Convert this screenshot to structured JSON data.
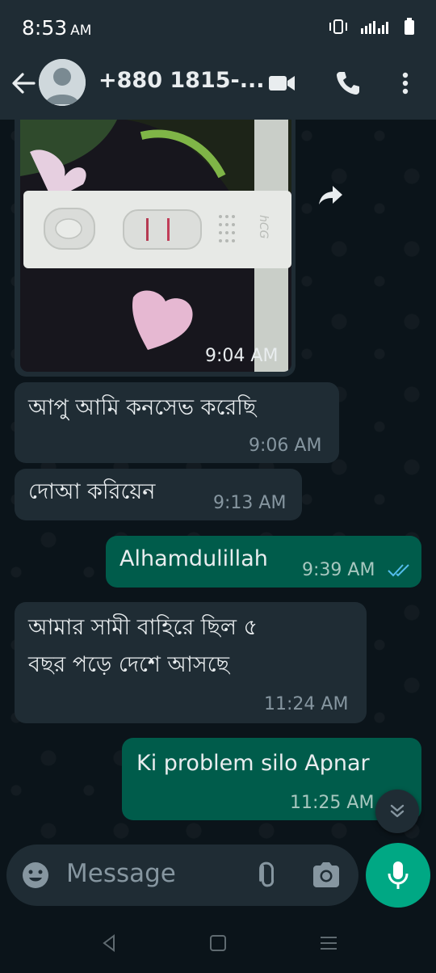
{
  "status_bar": {
    "time": "8:53",
    "ampm": "AM"
  },
  "header": {
    "contact_name": "+880 1815-..."
  },
  "messages": [
    {
      "direction": "in",
      "type": "image",
      "time": "9:04 AM",
      "image_text": "hCG"
    },
    {
      "direction": "in",
      "text": "আপু আমি কনসেভ করেছি",
      "time": "9:06 AM"
    },
    {
      "direction": "in",
      "text": "দোআ করিয়েন",
      "time": "9:13 AM"
    },
    {
      "direction": "out",
      "text": "Alhamdulillah",
      "time": "9:39 AM",
      "status": "read"
    },
    {
      "direction": "in",
      "text_lines": [
        "আমার সামী বাহিরে ছিল ৫",
        "বছর পড়ে দেশে আসছে"
      ],
      "time": "11:24 AM"
    },
    {
      "direction": "out",
      "text": "Ki problem silo Apnar",
      "time": "11:25 AM"
    }
  ],
  "composer": {
    "placeholder": "Message"
  },
  "colors": {
    "background": "#0b141a",
    "header": "#1f2c34",
    "incoming": "#1f2c34",
    "outgoing": "#005c4b",
    "accent": "#00a884",
    "read_ticks": "#53bdeb"
  }
}
